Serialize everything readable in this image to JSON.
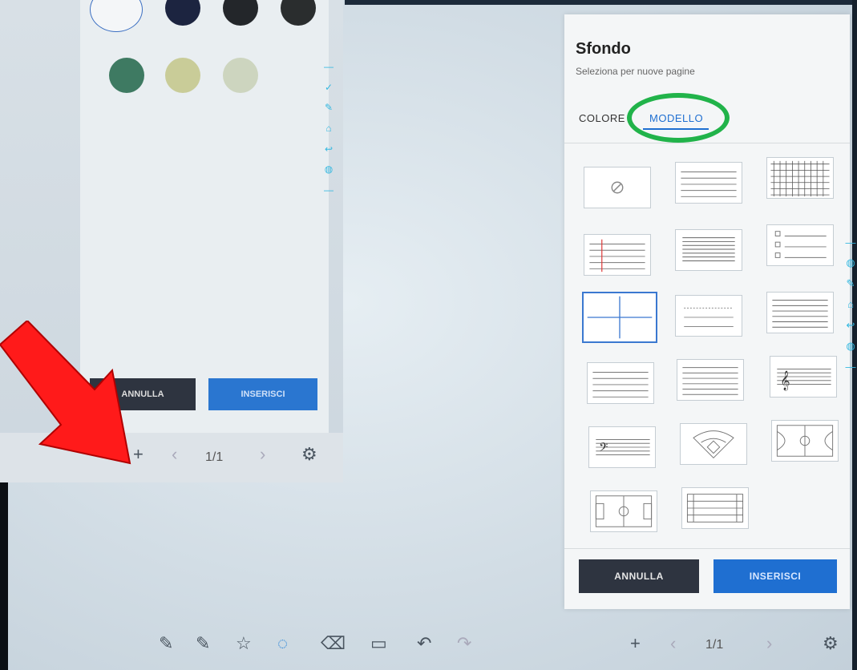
{
  "panel": {
    "title": "Sfondo",
    "subtitle": "Seleziona per nuove pagine",
    "tabs": [
      {
        "label": "COLORE",
        "active": false
      },
      {
        "label": "MODELLO",
        "active": true
      }
    ],
    "cancel_label": "ANNULLA",
    "insert_label": "INSERISCI",
    "templates": [
      "none-icon",
      "lined",
      "grid",
      "red-margin-lines",
      "dense-lines",
      "checklist",
      "four-quadrant",
      "sparse-lines",
      "notebook-lines",
      "lines-wide",
      "lines-medium",
      "treble-staff",
      "bass-staff",
      "baseball-field",
      "basketball-court",
      "soccer-field",
      "running-track"
    ],
    "selected_template": "four-quadrant"
  },
  "toolbar": {
    "page_indicator": "1/1"
  },
  "inset": {
    "cancel_label": "ANNULLA",
    "insert_label": "INSERISCI",
    "page_indicator": "1/1",
    "swatches": [
      "#f4f6f8",
      "#1c2440",
      "#23262a",
      "#2a2d2e",
      "#3e7a62",
      "#c9cc98",
      "#cdd5bf"
    ]
  },
  "colors": {
    "accent": "#1f6fd1",
    "highlight_ring": "#21b34a",
    "arrow": "#ff1a1a"
  }
}
